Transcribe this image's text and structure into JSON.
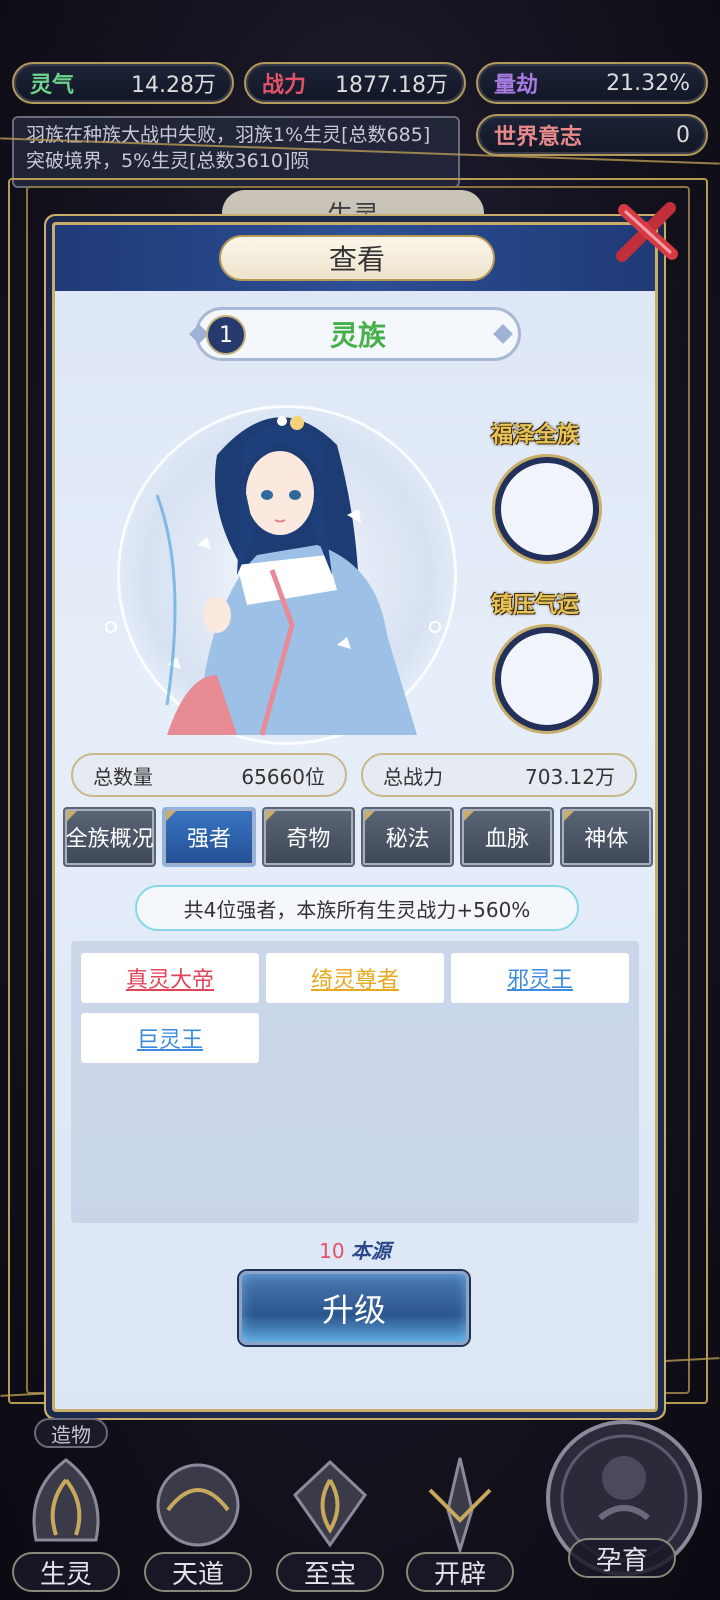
{
  "resources": {
    "lingqi": {
      "label": "灵气",
      "value": "14.28万"
    },
    "zhanli": {
      "label": "战力",
      "value": "1877.18万"
    },
    "liangjie": {
      "label": "量劫",
      "value": "21.32%"
    },
    "shijie_yizhi": {
      "label": "世界意志",
      "value": "0"
    }
  },
  "news": "羽族在种族大战中失败，羽族1%生灵[总数685]突破境界，5%生灵[总数3610]陨",
  "background_tab": "生灵",
  "dialog": {
    "title": "查看",
    "race": {
      "index": "1",
      "name": "灵族"
    },
    "slots": [
      {
        "label": "福泽全族"
      },
      {
        "label": "镇压气运"
      }
    ],
    "stats": {
      "total_count": {
        "label": "总数量",
        "value": "65660位"
      },
      "total_power": {
        "label": "总战力",
        "value": "703.12万"
      }
    },
    "tabs": [
      "全族概况",
      "强者",
      "奇物",
      "秘法",
      "血脉",
      "神体"
    ],
    "active_tab": "强者",
    "summary": "共4位强者，本族所有生灵战力+560%",
    "strongmen": [
      {
        "name": "真灵大帝",
        "color": "#e0455a"
      },
      {
        "name": "绮灵尊者",
        "color": "#e6a81e"
      },
      {
        "name": "邪灵王",
        "color": "#3d8be0"
      },
      {
        "name": "巨灵王",
        "color": "#3d8be0"
      }
    ],
    "cost": {
      "amount": "10",
      "unit": "本源"
    },
    "upgrade_label": "升级"
  },
  "bottom_nav": {
    "zaowu": "造物",
    "items": [
      "生灵",
      "天道",
      "至宝",
      "开辟"
    ],
    "yunyu": "孕育"
  }
}
